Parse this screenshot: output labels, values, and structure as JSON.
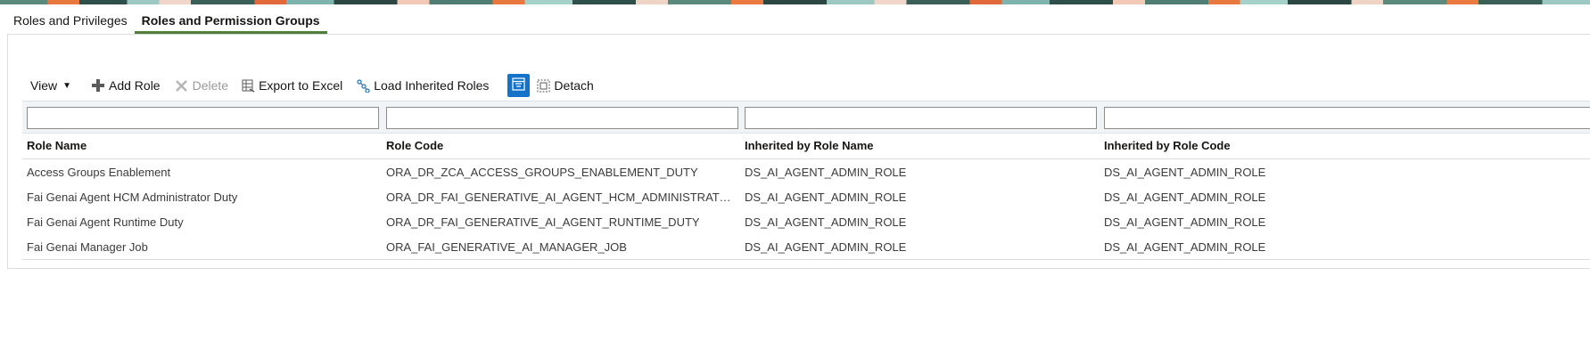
{
  "tabs": [
    {
      "label": "Roles and Privileges",
      "active": false
    },
    {
      "label": "Roles and Permission Groups",
      "active": true
    }
  ],
  "toolbar": {
    "view_label": "View",
    "add_label": "Add Role",
    "delete_label": "Delete",
    "export_label": "Export to Excel",
    "load_label": "Load Inherited Roles",
    "detach_label": "Detach"
  },
  "table": {
    "columns": [
      "Role Name",
      "Role Code",
      "Inherited by Role Name",
      "Inherited by Role Code"
    ],
    "rows": [
      [
        "Access Groups Enablement",
        "ORA_DR_ZCA_ACCESS_GROUPS_ENABLEMENT_DUTY",
        "DS_AI_AGENT_ADMIN_ROLE",
        "DS_AI_AGENT_ADMIN_ROLE"
      ],
      [
        "Fai Genai Agent HCM Administrator Duty",
        "ORA_DR_FAI_GENERATIVE_AI_AGENT_HCM_ADMINISTRATOR_DUTY",
        "DS_AI_AGENT_ADMIN_ROLE",
        "DS_AI_AGENT_ADMIN_ROLE"
      ],
      [
        "Fai Genai Agent Runtime Duty",
        "ORA_DR_FAI_GENERATIVE_AI_AGENT_RUNTIME_DUTY",
        "DS_AI_AGENT_ADMIN_ROLE",
        "DS_AI_AGENT_ADMIN_ROLE"
      ],
      [
        "Fai Genai Manager Job",
        "ORA_FAI_GENERATIVE_AI_MANAGER_JOB",
        "DS_AI_AGENT_ADMIN_ROLE",
        "DS_AI_AGENT_ADMIN_ROLE"
      ]
    ]
  },
  "colors": {
    "active_tab_underline": "#4f7d3a",
    "freeze_button_bg": "#1473c8",
    "disabled_text": "#9b9b9b"
  }
}
